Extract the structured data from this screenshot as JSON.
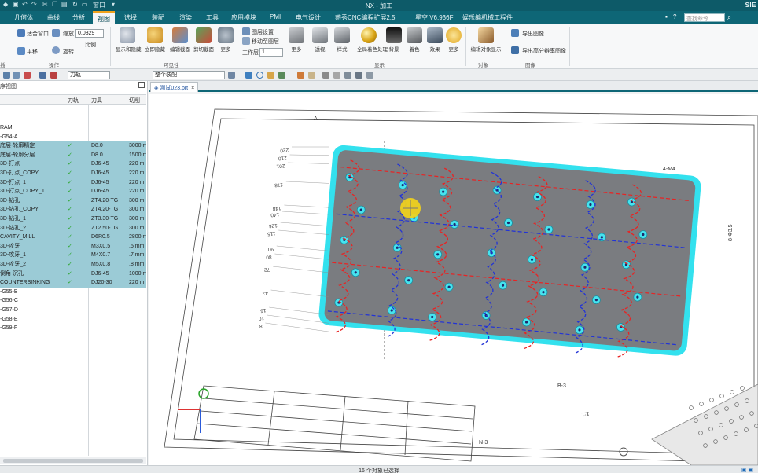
{
  "titlebar": {
    "title": "NX - 加工",
    "brand": "SIE",
    "quick_access": "窗口",
    "quick_access_arrow": "▾"
  },
  "menu": {
    "tabs": [
      "几何体",
      "曲线",
      "分析",
      "视图",
      "选择",
      "装配",
      "渲染",
      "工具",
      "应用模块",
      "PMI",
      "电气设计",
      "燕秀CNC编程扩展2.5",
      "星空 V6.936F",
      "娱乐编机械工程件"
    ],
    "active_tab": "视图",
    "search_placeholder": "查找命令"
  },
  "ribbon": {
    "window_group": {
      "reorient": "适合窗口",
      "pan": "平移",
      "zoom_label": "缩放",
      "zoom_value": "0.0329",
      "scale_label": "比例",
      "rotate": "旋转",
      "group": "操作"
    },
    "visibility_group": {
      "items": [
        "显示和隐藏",
        "立即隐藏",
        "编辑截面",
        "剪切截面",
        "更多"
      ],
      "small_items": [
        "图层设置",
        "移动至图层"
      ],
      "work_layer_label": "工作层",
      "work_layer_value": "1",
      "group": "可见性"
    },
    "style_group": {
      "items": [
        "更多",
        "透视",
        "样式",
        "全局着色处理",
        "背景",
        "着色",
        "效果",
        "更多"
      ],
      "group": "显示"
    },
    "object_group": {
      "items": [
        "编辑对象显示"
      ],
      "group": "对象"
    },
    "export_group": {
      "items": [
        "导出图像",
        "导出高分辨率图像"
      ],
      "group": "图像"
    },
    "group_first": "插",
    "group_last": "可"
  },
  "toolbar2": {
    "filter_value": "刀轨",
    "scope_value": "整个装配"
  },
  "navigator": {
    "title": "序视图",
    "columns": [
      "",
      "刀轨",
      "刀具",
      "切削"
    ],
    "rows": [
      {
        "name": "RAM",
        "check": "",
        "tool": "",
        "feed": "",
        "selected": false
      },
      {
        "name": "-G54-A",
        "check": "",
        "tool": "",
        "feed": "",
        "selected": false
      },
      {
        "name": "底层-轮廓精定",
        "check": "✓",
        "tool": "D8.0",
        "feed": "3000 m",
        "selected": true
      },
      {
        "name": "底层-轮廓分层",
        "check": "✓",
        "tool": "D8.0",
        "feed": "1500 m",
        "selected": true
      },
      {
        "name": "3D-打点",
        "check": "✓",
        "tool": "DJ6-45",
        "feed": "220 m",
        "selected": true
      },
      {
        "name": "3D-打点_COPY",
        "check": "✓",
        "tool": "DJ6-45",
        "feed": "220 m",
        "selected": true
      },
      {
        "name": "3D-打点_1",
        "check": "✓",
        "tool": "DJ6-45",
        "feed": "220 m",
        "selected": true
      },
      {
        "name": "3D-打点_COPY_1",
        "check": "✓",
        "tool": "DJ6-45",
        "feed": "220 m",
        "selected": true
      },
      {
        "name": "3D-钻孔",
        "check": "✓",
        "tool": "ZT4.20-TG",
        "feed": "300 m",
        "selected": true
      },
      {
        "name": "3D-钻孔_COPY",
        "check": "✓",
        "tool": "ZT4.20-TG",
        "feed": "300 m",
        "selected": true
      },
      {
        "name": "3D-钻孔_1",
        "check": "✓",
        "tool": "ZT3.30-TG",
        "feed": "300 m",
        "selected": true
      },
      {
        "name": "3D-钻孔_2",
        "check": "✓",
        "tool": "ZT2.50-TG",
        "feed": "300 m",
        "selected": true
      },
      {
        "name": "CAVITY_MILL",
        "check": "✓",
        "tool": "D6R0.5",
        "feed": "2800 m",
        "selected": true
      },
      {
        "name": "3D-攻牙",
        "check": "✓",
        "tool": "M3X0.5",
        "feed": ".5 mm",
        "selected": true
      },
      {
        "name": "3D-攻牙_1",
        "check": "✓",
        "tool": "M4X0.7",
        "feed": ".7 mm",
        "selected": true
      },
      {
        "name": "3D-攻牙_2",
        "check": "✓",
        "tool": "M5X0.8",
        "feed": ".8 mm",
        "selected": true
      },
      {
        "name": "倒角 沉孔",
        "check": "✓",
        "tool": "DJ6-45",
        "feed": "1000 m",
        "selected": true
      },
      {
        "name": "COUNTERSINKING",
        "check": "✓",
        "tool": "DJ20-30",
        "feed": "220 m",
        "selected": true
      },
      {
        "name": "-G55-B",
        "check": "",
        "tool": "",
        "feed": "",
        "selected": false
      },
      {
        "name": "-G56-C",
        "check": "",
        "tool": "",
        "feed": "",
        "selected": false
      },
      {
        "name": "-G57-D",
        "check": "",
        "tool": "",
        "feed": "",
        "selected": false
      },
      {
        "name": "-G58-E",
        "check": "",
        "tool": "",
        "feed": "",
        "selected": false
      },
      {
        "name": "-G59-F",
        "check": "",
        "tool": "",
        "feed": "",
        "selected": false
      }
    ]
  },
  "graphics": {
    "tab_label": "測試023.prt",
    "tab_close": "×",
    "dim_labels_left": [
      "220",
      "210",
      "201",
      "178",
      "148",
      "140",
      "126",
      "115",
      "90",
      "80",
      "72",
      "42",
      "15",
      "10",
      "8"
    ],
    "drawing_labels": [
      "A",
      "4-M4",
      "8-Φ3.5",
      "B-3",
      "1:1",
      "N-3"
    ]
  },
  "status": {
    "text": "16 个对象已选择"
  },
  "colors": {
    "menubar": "#0e6676",
    "titlebar": "#0d5a68",
    "selected_row": "#9bcbd6",
    "part_plate": "#7a7c80",
    "part_edge": "#33e1ee",
    "toolpath_red": "#e82323",
    "toolpath_blue": "#2233d6",
    "cursor_highlight": "#f1d21b"
  }
}
